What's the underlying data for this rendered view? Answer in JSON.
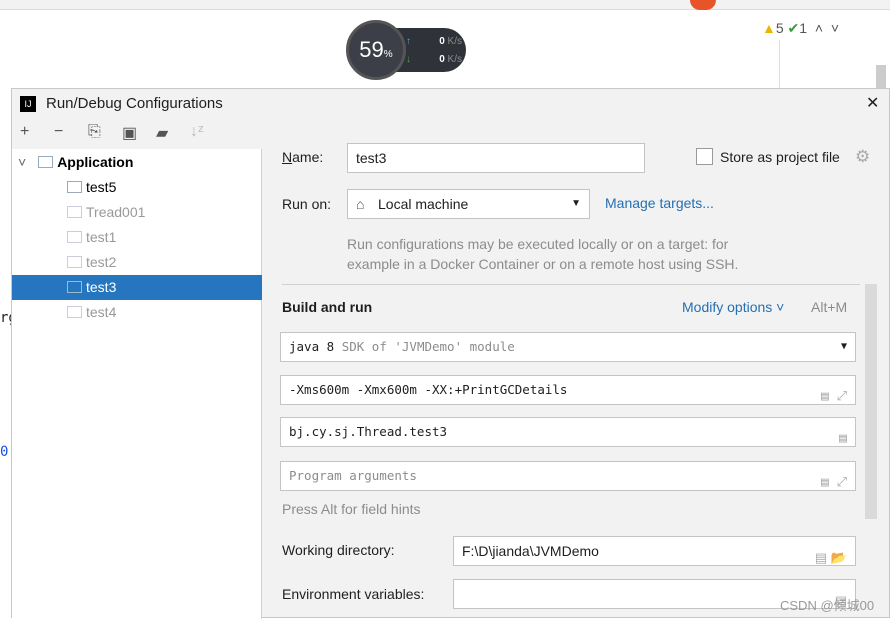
{
  "editor": {
    "frag1": "rg",
    "frag2": "0",
    "warnings": "5",
    "checks": "1"
  },
  "monitor": {
    "cpu": "59",
    "cpu_unit": "%",
    "up": "0",
    "down": "0",
    "unit": "K/s"
  },
  "dialog": {
    "title": "Run/Debug Configurations"
  },
  "tree": {
    "root": "Application",
    "items": [
      "test5",
      "Tread001",
      "test1",
      "test2",
      "test3",
      "test4"
    ],
    "selected": "test3"
  },
  "form": {
    "name_label": "Name:",
    "name_value": "test3",
    "store_label": "Store as project file",
    "store_checked": false,
    "runon_label": "Run on:",
    "runon_value": "Local machine",
    "manage_targets": "Manage targets...",
    "desc1": "Run configurations may be executed locally or on a target: for",
    "desc2": "example in a Docker Container or on a remote host using SSH.",
    "section": "Build and run",
    "modify_options": "Modify options",
    "modify_shortcut": "Alt+M",
    "jdk_main": "java 8",
    "jdk_sub": "SDK of 'JVMDemo' module",
    "vm_options": "-Xms600m -Xmx600m -XX:+PrintGCDetails",
    "main_class": "bj.cy.sj.Thread.test3",
    "program_args_placeholder": "Program arguments",
    "hint": "Press Alt for field hints",
    "workdir_label": "Working directory:",
    "workdir_value": "F:\\D\\jianda\\JVMDemo",
    "env_label": "Environment variables:",
    "env_value": ""
  },
  "watermark": "CSDN @倾城00"
}
